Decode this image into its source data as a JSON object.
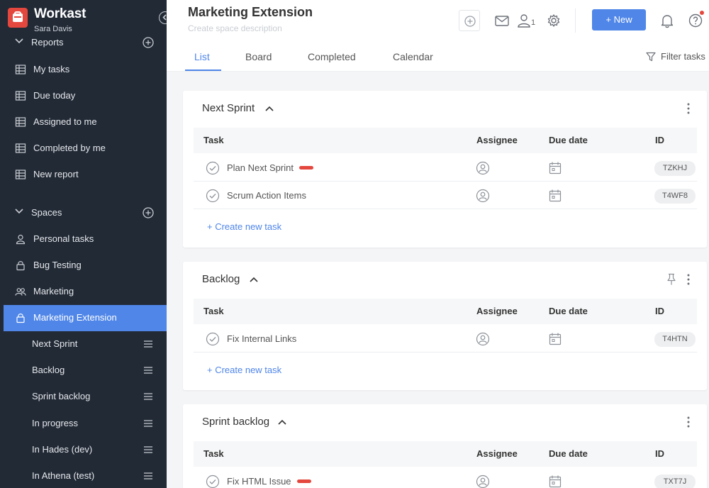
{
  "app": {
    "name": "Workast",
    "user": "Sara Davis"
  },
  "sidebar": {
    "reports_label": "Reports",
    "reports_items": [
      {
        "label": "My tasks",
        "icon": "table-icon"
      },
      {
        "label": "Due today",
        "icon": "table-icon"
      },
      {
        "label": "Assigned to me",
        "icon": "table-icon"
      },
      {
        "label": "Completed by me",
        "icon": "table-icon"
      },
      {
        "label": "New report",
        "icon": "table-icon"
      }
    ],
    "spaces_label": "Spaces",
    "spaces": [
      {
        "label": "Personal tasks",
        "icon": "person-icon"
      },
      {
        "label": "Bug Testing",
        "icon": "lock-icon"
      },
      {
        "label": "Marketing",
        "icon": "group-icon"
      },
      {
        "label": "Marketing Extension",
        "icon": "lock-icon",
        "active": true
      }
    ],
    "sub_items": [
      "Next Sprint",
      "Backlog",
      "Sprint backlog",
      "In progress",
      "In Hades (dev)",
      "In Athena (test)"
    ]
  },
  "header": {
    "title": "Marketing Extension",
    "description_placeholder": "Create space description",
    "member_count": "1",
    "new_button": "New"
  },
  "tabs": [
    "List",
    "Board",
    "Completed",
    "Calendar"
  ],
  "active_tab": "List",
  "filter_label": "Filter tasks",
  "columns": {
    "task": "Task",
    "assignee": "Assignee",
    "due": "Due date",
    "id": "ID"
  },
  "create_task_label": "+ Create new task",
  "sections": [
    {
      "title": "Next Sprint",
      "tasks": [
        {
          "name": "Plan Next Sprint",
          "id": "TZKHJ",
          "tag_color": "#e4473d"
        },
        {
          "name": "Scrum Action Items",
          "id": "T4WF8"
        }
      ]
    },
    {
      "title": "Backlog",
      "tasks": [
        {
          "name": "Fix Internal Links",
          "id": "T4HTN"
        }
      ]
    },
    {
      "title": "Sprint backlog",
      "tasks": [
        {
          "name": "Fix HTML Issue",
          "id": "TXT7J",
          "tag_color": "#e4473d"
        }
      ]
    }
  ],
  "colors": {
    "sidebar_bg": "#222a36",
    "accent": "#4f86e8",
    "brand_red": "#e4473d"
  }
}
